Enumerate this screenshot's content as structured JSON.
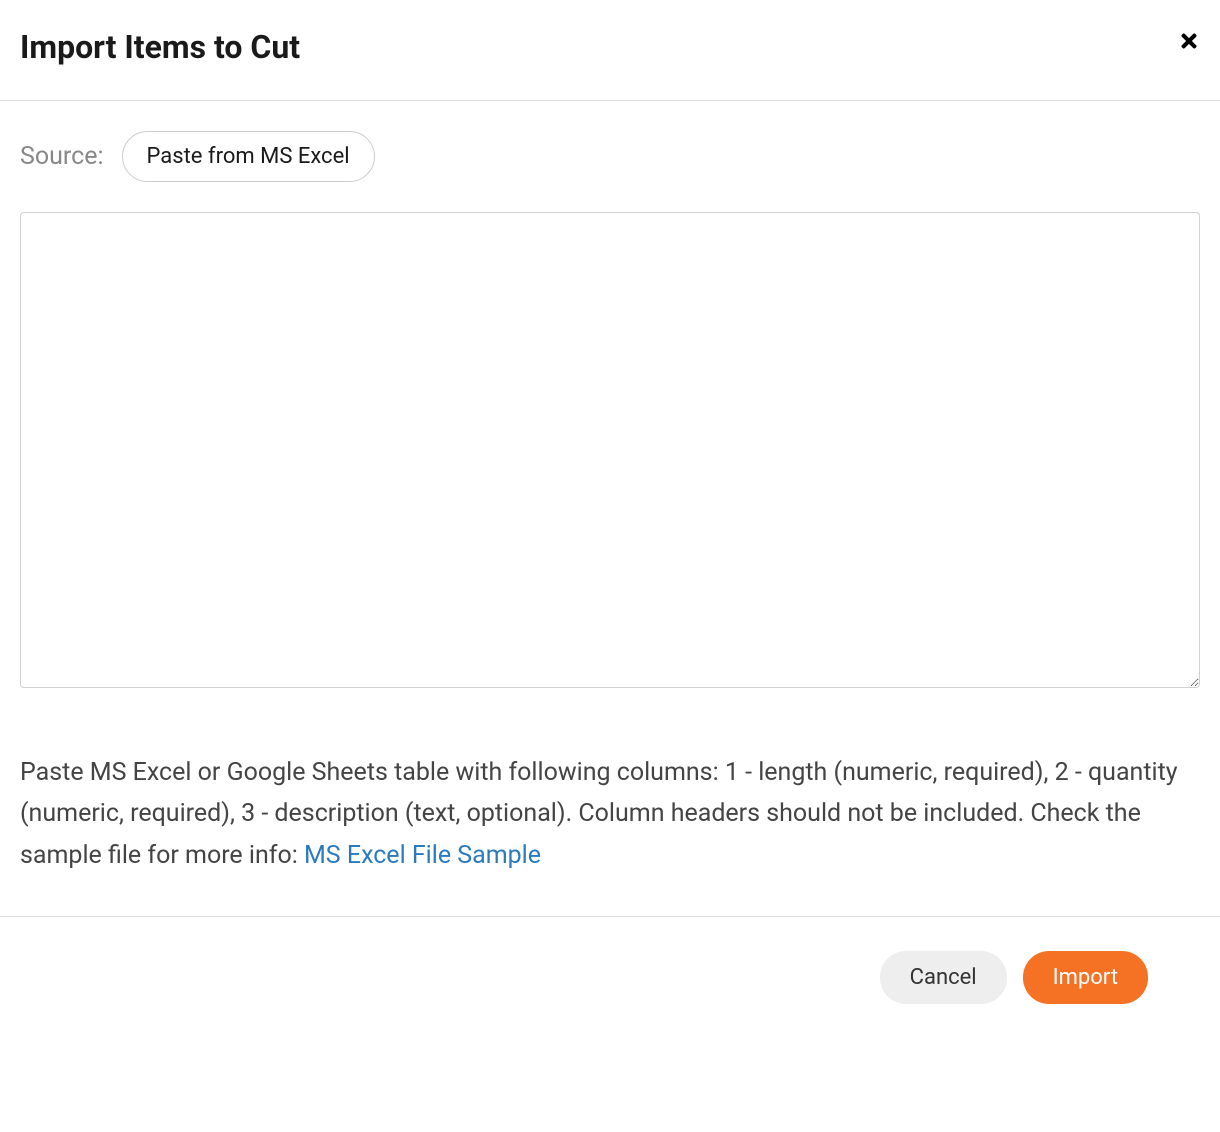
{
  "header": {
    "title": "Import Items to Cut"
  },
  "source": {
    "label": "Source:",
    "selected_option": "Paste from MS Excel"
  },
  "textarea": {
    "value": ""
  },
  "help": {
    "text": "Paste MS Excel or Google Sheets table with following columns: 1 - length (numeric, required), 2 - quantity (numeric, required), 3 - description (text, optional). Column headers should not be included. Check the sample file for more info: ",
    "link_text": "MS Excel File Sample"
  },
  "footer": {
    "cancel_label": "Cancel",
    "import_label": "Import"
  }
}
